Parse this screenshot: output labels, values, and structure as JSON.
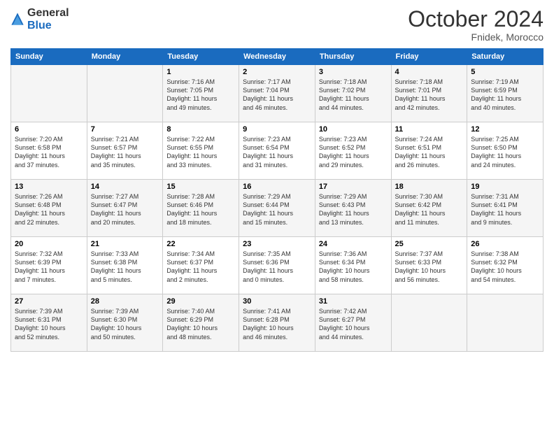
{
  "logo": {
    "general": "General",
    "blue": "Blue"
  },
  "title": "October 2024",
  "location": "Fnidek, Morocco",
  "days_header": [
    "Sunday",
    "Monday",
    "Tuesday",
    "Wednesday",
    "Thursday",
    "Friday",
    "Saturday"
  ],
  "weeks": [
    [
      {
        "day": "",
        "info": ""
      },
      {
        "day": "",
        "info": ""
      },
      {
        "day": "1",
        "info": "Sunrise: 7:16 AM\nSunset: 7:05 PM\nDaylight: 11 hours\nand 49 minutes."
      },
      {
        "day": "2",
        "info": "Sunrise: 7:17 AM\nSunset: 7:04 PM\nDaylight: 11 hours\nand 46 minutes."
      },
      {
        "day": "3",
        "info": "Sunrise: 7:18 AM\nSunset: 7:02 PM\nDaylight: 11 hours\nand 44 minutes."
      },
      {
        "day": "4",
        "info": "Sunrise: 7:18 AM\nSunset: 7:01 PM\nDaylight: 11 hours\nand 42 minutes."
      },
      {
        "day": "5",
        "info": "Sunrise: 7:19 AM\nSunset: 6:59 PM\nDaylight: 11 hours\nand 40 minutes."
      }
    ],
    [
      {
        "day": "6",
        "info": "Sunrise: 7:20 AM\nSunset: 6:58 PM\nDaylight: 11 hours\nand 37 minutes."
      },
      {
        "day": "7",
        "info": "Sunrise: 7:21 AM\nSunset: 6:57 PM\nDaylight: 11 hours\nand 35 minutes."
      },
      {
        "day": "8",
        "info": "Sunrise: 7:22 AM\nSunset: 6:55 PM\nDaylight: 11 hours\nand 33 minutes."
      },
      {
        "day": "9",
        "info": "Sunrise: 7:23 AM\nSunset: 6:54 PM\nDaylight: 11 hours\nand 31 minutes."
      },
      {
        "day": "10",
        "info": "Sunrise: 7:23 AM\nSunset: 6:52 PM\nDaylight: 11 hours\nand 29 minutes."
      },
      {
        "day": "11",
        "info": "Sunrise: 7:24 AM\nSunset: 6:51 PM\nDaylight: 11 hours\nand 26 minutes."
      },
      {
        "day": "12",
        "info": "Sunrise: 7:25 AM\nSunset: 6:50 PM\nDaylight: 11 hours\nand 24 minutes."
      }
    ],
    [
      {
        "day": "13",
        "info": "Sunrise: 7:26 AM\nSunset: 6:48 PM\nDaylight: 11 hours\nand 22 minutes."
      },
      {
        "day": "14",
        "info": "Sunrise: 7:27 AM\nSunset: 6:47 PM\nDaylight: 11 hours\nand 20 minutes."
      },
      {
        "day": "15",
        "info": "Sunrise: 7:28 AM\nSunset: 6:46 PM\nDaylight: 11 hours\nand 18 minutes."
      },
      {
        "day": "16",
        "info": "Sunrise: 7:29 AM\nSunset: 6:44 PM\nDaylight: 11 hours\nand 15 minutes."
      },
      {
        "day": "17",
        "info": "Sunrise: 7:29 AM\nSunset: 6:43 PM\nDaylight: 11 hours\nand 13 minutes."
      },
      {
        "day": "18",
        "info": "Sunrise: 7:30 AM\nSunset: 6:42 PM\nDaylight: 11 hours\nand 11 minutes."
      },
      {
        "day": "19",
        "info": "Sunrise: 7:31 AM\nSunset: 6:41 PM\nDaylight: 11 hours\nand 9 minutes."
      }
    ],
    [
      {
        "day": "20",
        "info": "Sunrise: 7:32 AM\nSunset: 6:39 PM\nDaylight: 11 hours\nand 7 minutes."
      },
      {
        "day": "21",
        "info": "Sunrise: 7:33 AM\nSunset: 6:38 PM\nDaylight: 11 hours\nand 5 minutes."
      },
      {
        "day": "22",
        "info": "Sunrise: 7:34 AM\nSunset: 6:37 PM\nDaylight: 11 hours\nand 2 minutes."
      },
      {
        "day": "23",
        "info": "Sunrise: 7:35 AM\nSunset: 6:36 PM\nDaylight: 11 hours\nand 0 minutes."
      },
      {
        "day": "24",
        "info": "Sunrise: 7:36 AM\nSunset: 6:34 PM\nDaylight: 10 hours\nand 58 minutes."
      },
      {
        "day": "25",
        "info": "Sunrise: 7:37 AM\nSunset: 6:33 PM\nDaylight: 10 hours\nand 56 minutes."
      },
      {
        "day": "26",
        "info": "Sunrise: 7:38 AM\nSunset: 6:32 PM\nDaylight: 10 hours\nand 54 minutes."
      }
    ],
    [
      {
        "day": "27",
        "info": "Sunrise: 7:39 AM\nSunset: 6:31 PM\nDaylight: 10 hours\nand 52 minutes."
      },
      {
        "day": "28",
        "info": "Sunrise: 7:39 AM\nSunset: 6:30 PM\nDaylight: 10 hours\nand 50 minutes."
      },
      {
        "day": "29",
        "info": "Sunrise: 7:40 AM\nSunset: 6:29 PM\nDaylight: 10 hours\nand 48 minutes."
      },
      {
        "day": "30",
        "info": "Sunrise: 7:41 AM\nSunset: 6:28 PM\nDaylight: 10 hours\nand 46 minutes."
      },
      {
        "day": "31",
        "info": "Sunrise: 7:42 AM\nSunset: 6:27 PM\nDaylight: 10 hours\nand 44 minutes."
      },
      {
        "day": "",
        "info": ""
      },
      {
        "day": "",
        "info": ""
      }
    ]
  ]
}
